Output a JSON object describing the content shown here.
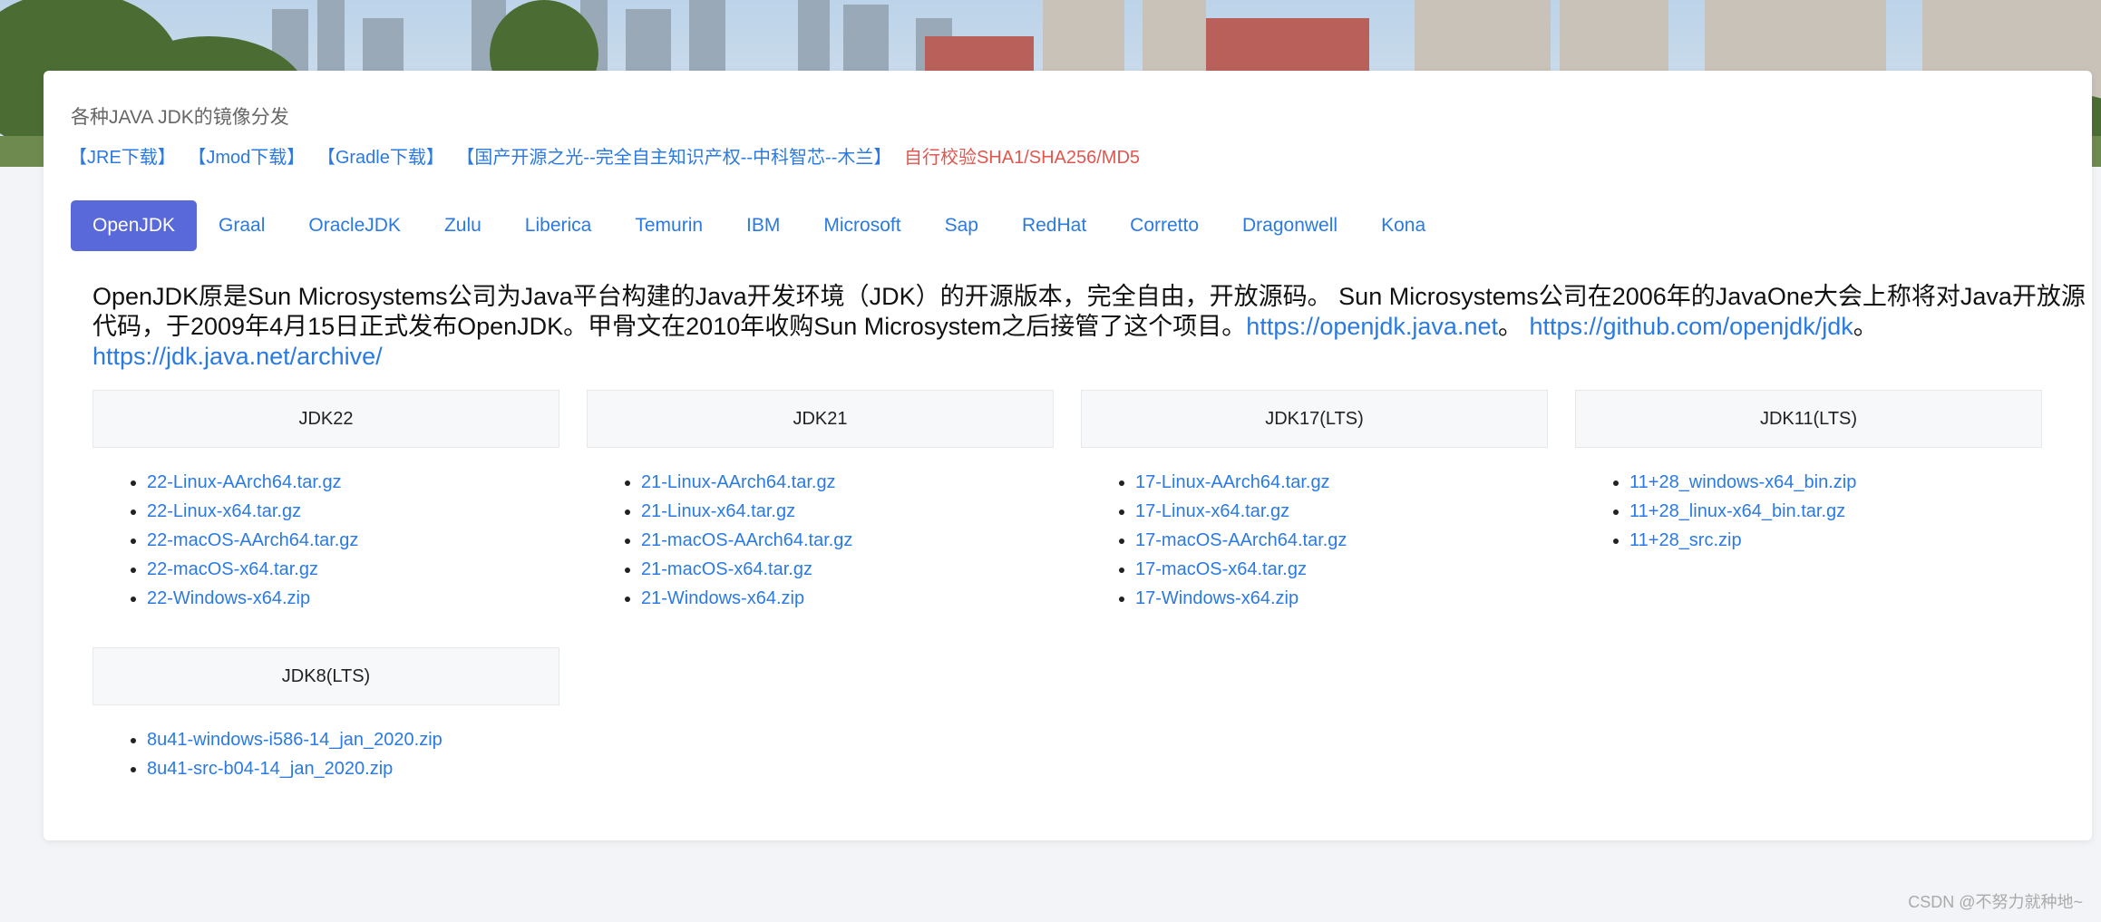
{
  "header": {
    "title": "各种JAVA JDK的镜像分发",
    "links": [
      "【JRE下载】",
      "【Jmod下载】",
      "【Gradle下载】",
      "【国产开源之光--完全自主知识产权--中科智芯--木兰】"
    ],
    "verify_link": "自行校验SHA1/SHA256/MD5"
  },
  "tabs": [
    "OpenJDK",
    "Graal",
    "OracleJDK",
    "Zulu",
    "Liberica",
    "Temurin",
    "IBM",
    "Microsoft",
    "Sap",
    "RedHat",
    "Corretto",
    "Dragonwell",
    "Kona"
  ],
  "active_tab": "OpenJDK",
  "description": {
    "text": "OpenJDK原是Sun Microsystems公司为Java平台构建的Java开发环境（JDK）的开源版本，完全自由，开放源码。 Sun Microsystems公司在2006年的JavaOne大会上称将对Java开放源代码，于2009年4月15日正式发布OpenJDK。甲骨文在2010年收购Sun Microsystem之后接管了这个项目。",
    "link1": "https://openjdk.java.net",
    "sep": "。 ",
    "link2": "https://github.com/openjdk/jdk",
    "link3": "https://jdk.java.net/archive/"
  },
  "jdk": {
    "jdk22": {
      "title": "JDK22",
      "files": [
        "22-Linux-AArch64.tar.gz",
        "22-Linux-x64.tar.gz",
        "22-macOS-AArch64.tar.gz",
        "22-macOS-x64.tar.gz",
        "22-Windows-x64.zip"
      ]
    },
    "jdk21": {
      "title": "JDK21",
      "files": [
        "21-Linux-AArch64.tar.gz",
        "21-Linux-x64.tar.gz",
        "21-macOS-AArch64.tar.gz",
        "21-macOS-x64.tar.gz",
        "21-Windows-x64.zip"
      ]
    },
    "jdk17": {
      "title": "JDK17(LTS)",
      "files": [
        "17-Linux-AArch64.tar.gz",
        "17-Linux-x64.tar.gz",
        "17-macOS-AArch64.tar.gz",
        "17-macOS-x64.tar.gz",
        "17-Windows-x64.zip"
      ]
    },
    "jdk11": {
      "title": "JDK11(LTS)",
      "files": [
        "11+28_windows-x64_bin.zip",
        "11+28_linux-x64_bin.tar.gz",
        "11+28_src.zip"
      ]
    },
    "jdk8": {
      "title": "JDK8(LTS)",
      "files": [
        "8u41-windows-i586-14_jan_2020.zip",
        "8u41-src-b04-14_jan_2020.zip"
      ]
    }
  },
  "watermark": "CSDN @不努力就种地~",
  "colors": {
    "link": "#2a7ae2",
    "tab_active_bg": "#5a69d9",
    "warn_link": "#e0574f"
  }
}
